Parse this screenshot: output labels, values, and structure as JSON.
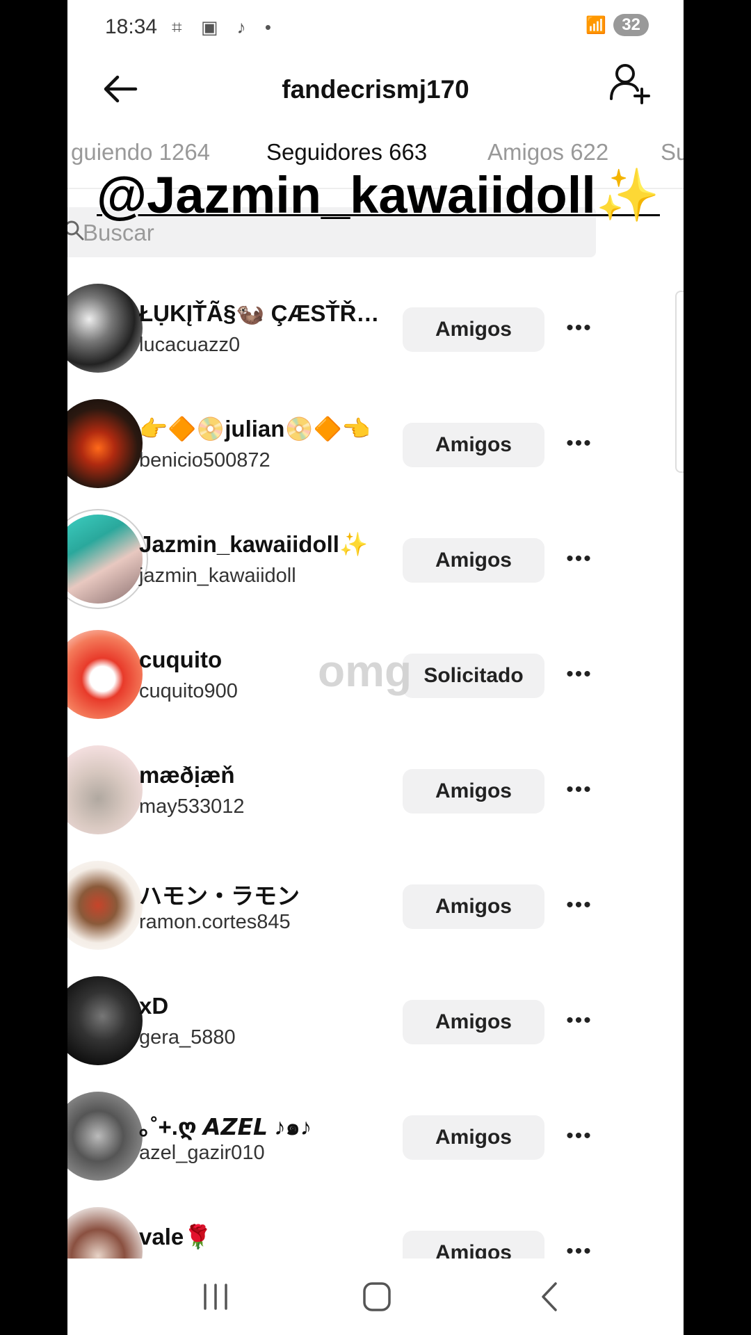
{
  "status_bar": {
    "time": "18:34",
    "battery": "32"
  },
  "header": {
    "title": "fandecrismj170"
  },
  "tabs": [
    {
      "label": "guiendo 1264"
    },
    {
      "label": "Seguidores 663"
    },
    {
      "label": "Amigos 622"
    },
    {
      "label": "Su"
    }
  ],
  "overlay": {
    "handle": "@Jazmin_kawaiidoll✨",
    "watermark": "omg"
  },
  "search": {
    "placeholder": "Buscar"
  },
  "users": [
    {
      "name": "ŁỤKĮŤÃ§🦦 ÇÆSŤŘ…",
      "username": "lucacuazz0",
      "button": "Amigos",
      "more": "•••"
    },
    {
      "name": "👉🔶📀julian📀🔶👈",
      "username": "benicio500872",
      "button": "Amigos",
      "more": "•••"
    },
    {
      "name": "Jazmin_kawaiidoll✨",
      "username": "jazmin_kawaiidoll",
      "button": "Amigos",
      "more": "•••"
    },
    {
      "name": "cuquito",
      "username": "cuquito900",
      "button": "Solicitado",
      "more": "•••"
    },
    {
      "name": "mæðịæň",
      "username": "may533012",
      "button": "Amigos",
      "more": "•••"
    },
    {
      "name": "ハモン・ラモン",
      "username": "ramon.cortes845",
      "button": "Amigos",
      "more": "•••"
    },
    {
      "name": "xD",
      "username": "gera_5880",
      "button": "Amigos",
      "more": "•••"
    },
    {
      "name": "｡˚+.ღ 𝘼𝙕𝙀𝙇 ♪๑♪",
      "username": "azel_gazir010",
      "button": "Amigos",
      "more": "•••"
    },
    {
      "name": "vale🌹",
      "username": "",
      "button": "Amigos",
      "more": "•••"
    }
  ]
}
